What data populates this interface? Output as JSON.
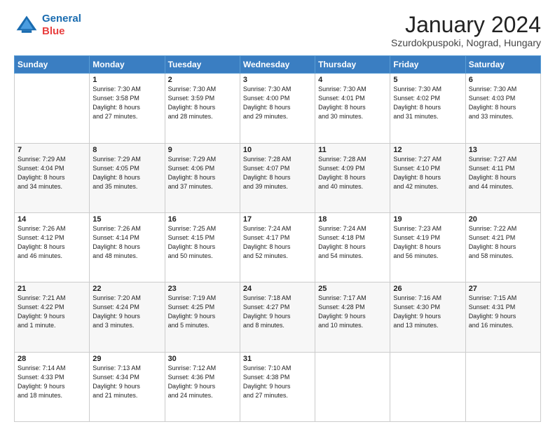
{
  "header": {
    "logo_line1": "General",
    "logo_line2": "Blue",
    "month": "January 2024",
    "location": "Szurdokpuspoki, Nograd, Hungary"
  },
  "weekdays": [
    "Sunday",
    "Monday",
    "Tuesday",
    "Wednesday",
    "Thursday",
    "Friday",
    "Saturday"
  ],
  "weeks": [
    [
      {
        "day": "",
        "text": ""
      },
      {
        "day": "1",
        "text": "Sunrise: 7:30 AM\nSunset: 3:58 PM\nDaylight: 8 hours\nand 27 minutes."
      },
      {
        "day": "2",
        "text": "Sunrise: 7:30 AM\nSunset: 3:59 PM\nDaylight: 8 hours\nand 28 minutes."
      },
      {
        "day": "3",
        "text": "Sunrise: 7:30 AM\nSunset: 4:00 PM\nDaylight: 8 hours\nand 29 minutes."
      },
      {
        "day": "4",
        "text": "Sunrise: 7:30 AM\nSunset: 4:01 PM\nDaylight: 8 hours\nand 30 minutes."
      },
      {
        "day": "5",
        "text": "Sunrise: 7:30 AM\nSunset: 4:02 PM\nDaylight: 8 hours\nand 31 minutes."
      },
      {
        "day": "6",
        "text": "Sunrise: 7:30 AM\nSunset: 4:03 PM\nDaylight: 8 hours\nand 33 minutes."
      }
    ],
    [
      {
        "day": "7",
        "text": "Sunrise: 7:29 AM\nSunset: 4:04 PM\nDaylight: 8 hours\nand 34 minutes."
      },
      {
        "day": "8",
        "text": "Sunrise: 7:29 AM\nSunset: 4:05 PM\nDaylight: 8 hours\nand 35 minutes."
      },
      {
        "day": "9",
        "text": "Sunrise: 7:29 AM\nSunset: 4:06 PM\nDaylight: 8 hours\nand 37 minutes."
      },
      {
        "day": "10",
        "text": "Sunrise: 7:28 AM\nSunset: 4:07 PM\nDaylight: 8 hours\nand 39 minutes."
      },
      {
        "day": "11",
        "text": "Sunrise: 7:28 AM\nSunset: 4:09 PM\nDaylight: 8 hours\nand 40 minutes."
      },
      {
        "day": "12",
        "text": "Sunrise: 7:27 AM\nSunset: 4:10 PM\nDaylight: 8 hours\nand 42 minutes."
      },
      {
        "day": "13",
        "text": "Sunrise: 7:27 AM\nSunset: 4:11 PM\nDaylight: 8 hours\nand 44 minutes."
      }
    ],
    [
      {
        "day": "14",
        "text": "Sunrise: 7:26 AM\nSunset: 4:12 PM\nDaylight: 8 hours\nand 46 minutes."
      },
      {
        "day": "15",
        "text": "Sunrise: 7:26 AM\nSunset: 4:14 PM\nDaylight: 8 hours\nand 48 minutes."
      },
      {
        "day": "16",
        "text": "Sunrise: 7:25 AM\nSunset: 4:15 PM\nDaylight: 8 hours\nand 50 minutes."
      },
      {
        "day": "17",
        "text": "Sunrise: 7:24 AM\nSunset: 4:17 PM\nDaylight: 8 hours\nand 52 minutes."
      },
      {
        "day": "18",
        "text": "Sunrise: 7:24 AM\nSunset: 4:18 PM\nDaylight: 8 hours\nand 54 minutes."
      },
      {
        "day": "19",
        "text": "Sunrise: 7:23 AM\nSunset: 4:19 PM\nDaylight: 8 hours\nand 56 minutes."
      },
      {
        "day": "20",
        "text": "Sunrise: 7:22 AM\nSunset: 4:21 PM\nDaylight: 8 hours\nand 58 minutes."
      }
    ],
    [
      {
        "day": "21",
        "text": "Sunrise: 7:21 AM\nSunset: 4:22 PM\nDaylight: 9 hours\nand 1 minute."
      },
      {
        "day": "22",
        "text": "Sunrise: 7:20 AM\nSunset: 4:24 PM\nDaylight: 9 hours\nand 3 minutes."
      },
      {
        "day": "23",
        "text": "Sunrise: 7:19 AM\nSunset: 4:25 PM\nDaylight: 9 hours\nand 5 minutes."
      },
      {
        "day": "24",
        "text": "Sunrise: 7:18 AM\nSunset: 4:27 PM\nDaylight: 9 hours\nand 8 minutes."
      },
      {
        "day": "25",
        "text": "Sunrise: 7:17 AM\nSunset: 4:28 PM\nDaylight: 9 hours\nand 10 minutes."
      },
      {
        "day": "26",
        "text": "Sunrise: 7:16 AM\nSunset: 4:30 PM\nDaylight: 9 hours\nand 13 minutes."
      },
      {
        "day": "27",
        "text": "Sunrise: 7:15 AM\nSunset: 4:31 PM\nDaylight: 9 hours\nand 16 minutes."
      }
    ],
    [
      {
        "day": "28",
        "text": "Sunrise: 7:14 AM\nSunset: 4:33 PM\nDaylight: 9 hours\nand 18 minutes."
      },
      {
        "day": "29",
        "text": "Sunrise: 7:13 AM\nSunset: 4:34 PM\nDaylight: 9 hours\nand 21 minutes."
      },
      {
        "day": "30",
        "text": "Sunrise: 7:12 AM\nSunset: 4:36 PM\nDaylight: 9 hours\nand 24 minutes."
      },
      {
        "day": "31",
        "text": "Sunrise: 7:10 AM\nSunset: 4:38 PM\nDaylight: 9 hours\nand 27 minutes."
      },
      {
        "day": "",
        "text": ""
      },
      {
        "day": "",
        "text": ""
      },
      {
        "day": "",
        "text": ""
      }
    ]
  ]
}
